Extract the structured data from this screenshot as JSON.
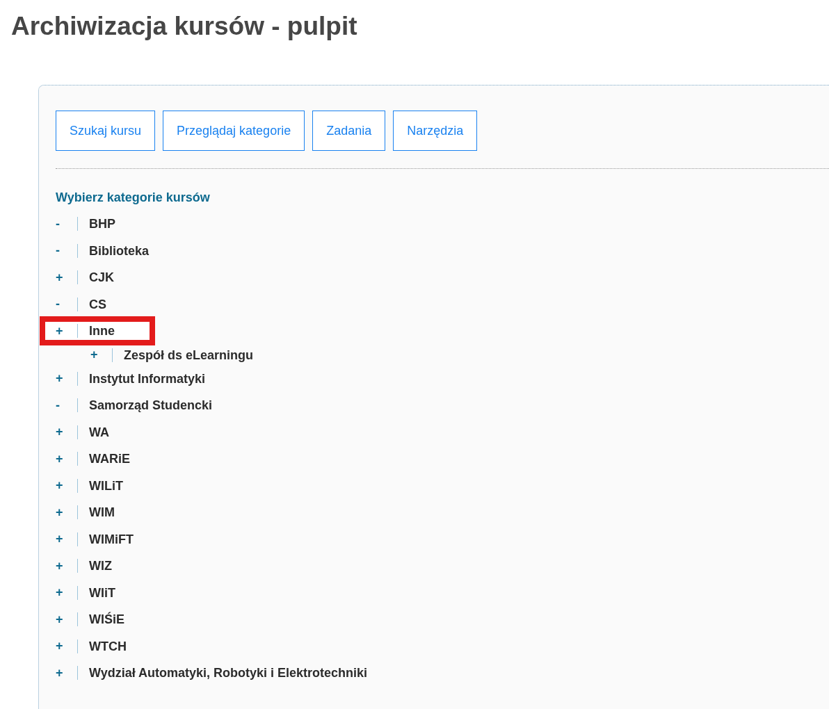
{
  "page": {
    "title": "Archiwizacja kursów - pulpit"
  },
  "buttons": [
    {
      "label": "Szukaj kursu"
    },
    {
      "label": "Przeglądaj kategorie"
    },
    {
      "label": "Zadania"
    },
    {
      "label": "Narzędzia"
    }
  ],
  "category_tree": {
    "heading": "Wybierz kategorie kursów",
    "items": [
      {
        "toggle": "-",
        "label": "BHP",
        "highlighted": false
      },
      {
        "toggle": "-",
        "label": "Biblioteka",
        "highlighted": false
      },
      {
        "toggle": "+",
        "label": "CJK",
        "highlighted": false
      },
      {
        "toggle": "-",
        "label": "CS",
        "highlighted": false
      },
      {
        "toggle": "+",
        "label": "Inne",
        "highlighted": true,
        "children": [
          {
            "toggle": "+",
            "label": "Zespół ds eLearningu",
            "highlighted": false
          }
        ]
      },
      {
        "toggle": "+",
        "label": "Instytut Informatyki",
        "highlighted": false
      },
      {
        "toggle": "-",
        "label": "Samorząd Studencki",
        "highlighted": false
      },
      {
        "toggle": "+",
        "label": "WA",
        "highlighted": false
      },
      {
        "toggle": "+",
        "label": "WARiE",
        "highlighted": false
      },
      {
        "toggle": "+",
        "label": "WILiT",
        "highlighted": false
      },
      {
        "toggle": "+",
        "label": "WIM",
        "highlighted": false
      },
      {
        "toggle": "+",
        "label": "WIMiFT",
        "highlighted": false
      },
      {
        "toggle": "+",
        "label": "WIZ",
        "highlighted": false
      },
      {
        "toggle": "+",
        "label": "WIiT",
        "highlighted": false
      },
      {
        "toggle": "+",
        "label": "WIŚiE",
        "highlighted": false
      },
      {
        "toggle": "+",
        "label": "WTCH",
        "highlighted": false
      },
      {
        "toggle": "+",
        "label": "Wydział Automatyki, Robotyki i Elektrotechniki",
        "highlighted": false
      }
    ]
  }
}
